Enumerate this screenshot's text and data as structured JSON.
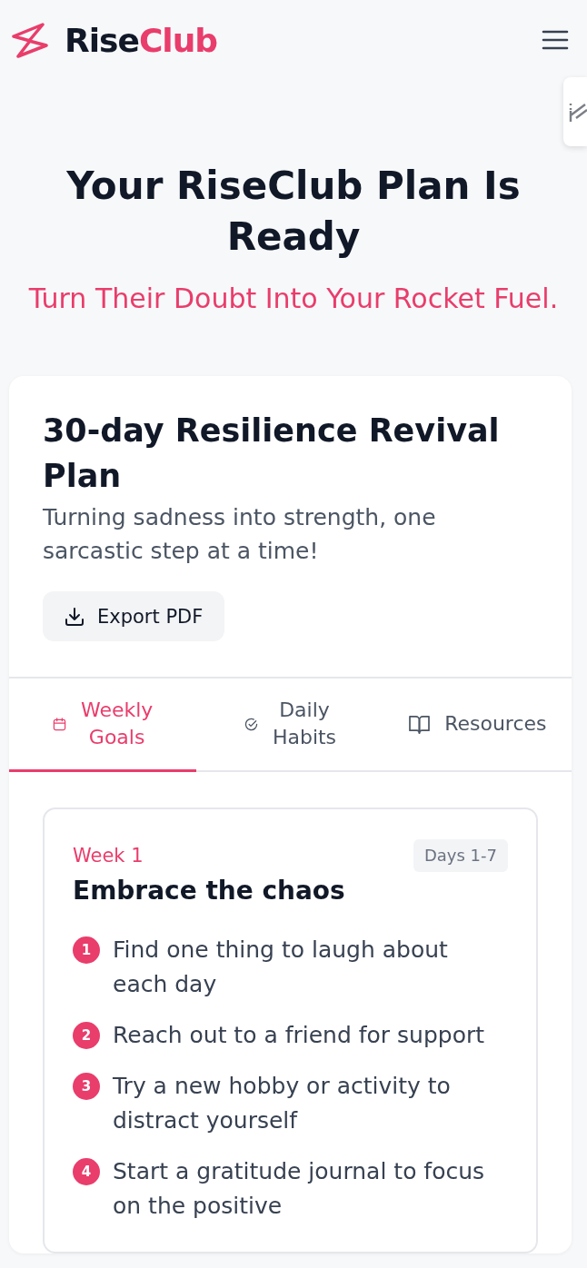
{
  "brand": {
    "name_dark": "Rise",
    "name_accent": "Club"
  },
  "hero": {
    "title": "Your RiseClub Plan Is Ready",
    "subtitle": "Turn Their Doubt Into Your Rocket Fuel."
  },
  "plan": {
    "title": "30-day Resilience Revival Plan",
    "description": "Turning sadness into strength, one sarcastic step at a time!",
    "export_button": "Export PDF",
    "tabs": [
      {
        "label": "Weekly Goals",
        "selected": true
      },
      {
        "label": "Daily Habits",
        "selected": false
      },
      {
        "label": "Resources",
        "selected": false
      }
    ],
    "week": {
      "label": "Week 1",
      "days": "Days 1-7",
      "title": "Embrace the chaos",
      "goals": [
        {
          "number": "1",
          "text": "Find one thing to laugh about each day"
        },
        {
          "number": "2",
          "text": "Reach out to a friend for support"
        },
        {
          "number": "3",
          "text": "Try a new hobby or activity to distract yourself"
        },
        {
          "number": "4",
          "text": "Start a gratitude journal to focus on the positive"
        }
      ]
    }
  }
}
